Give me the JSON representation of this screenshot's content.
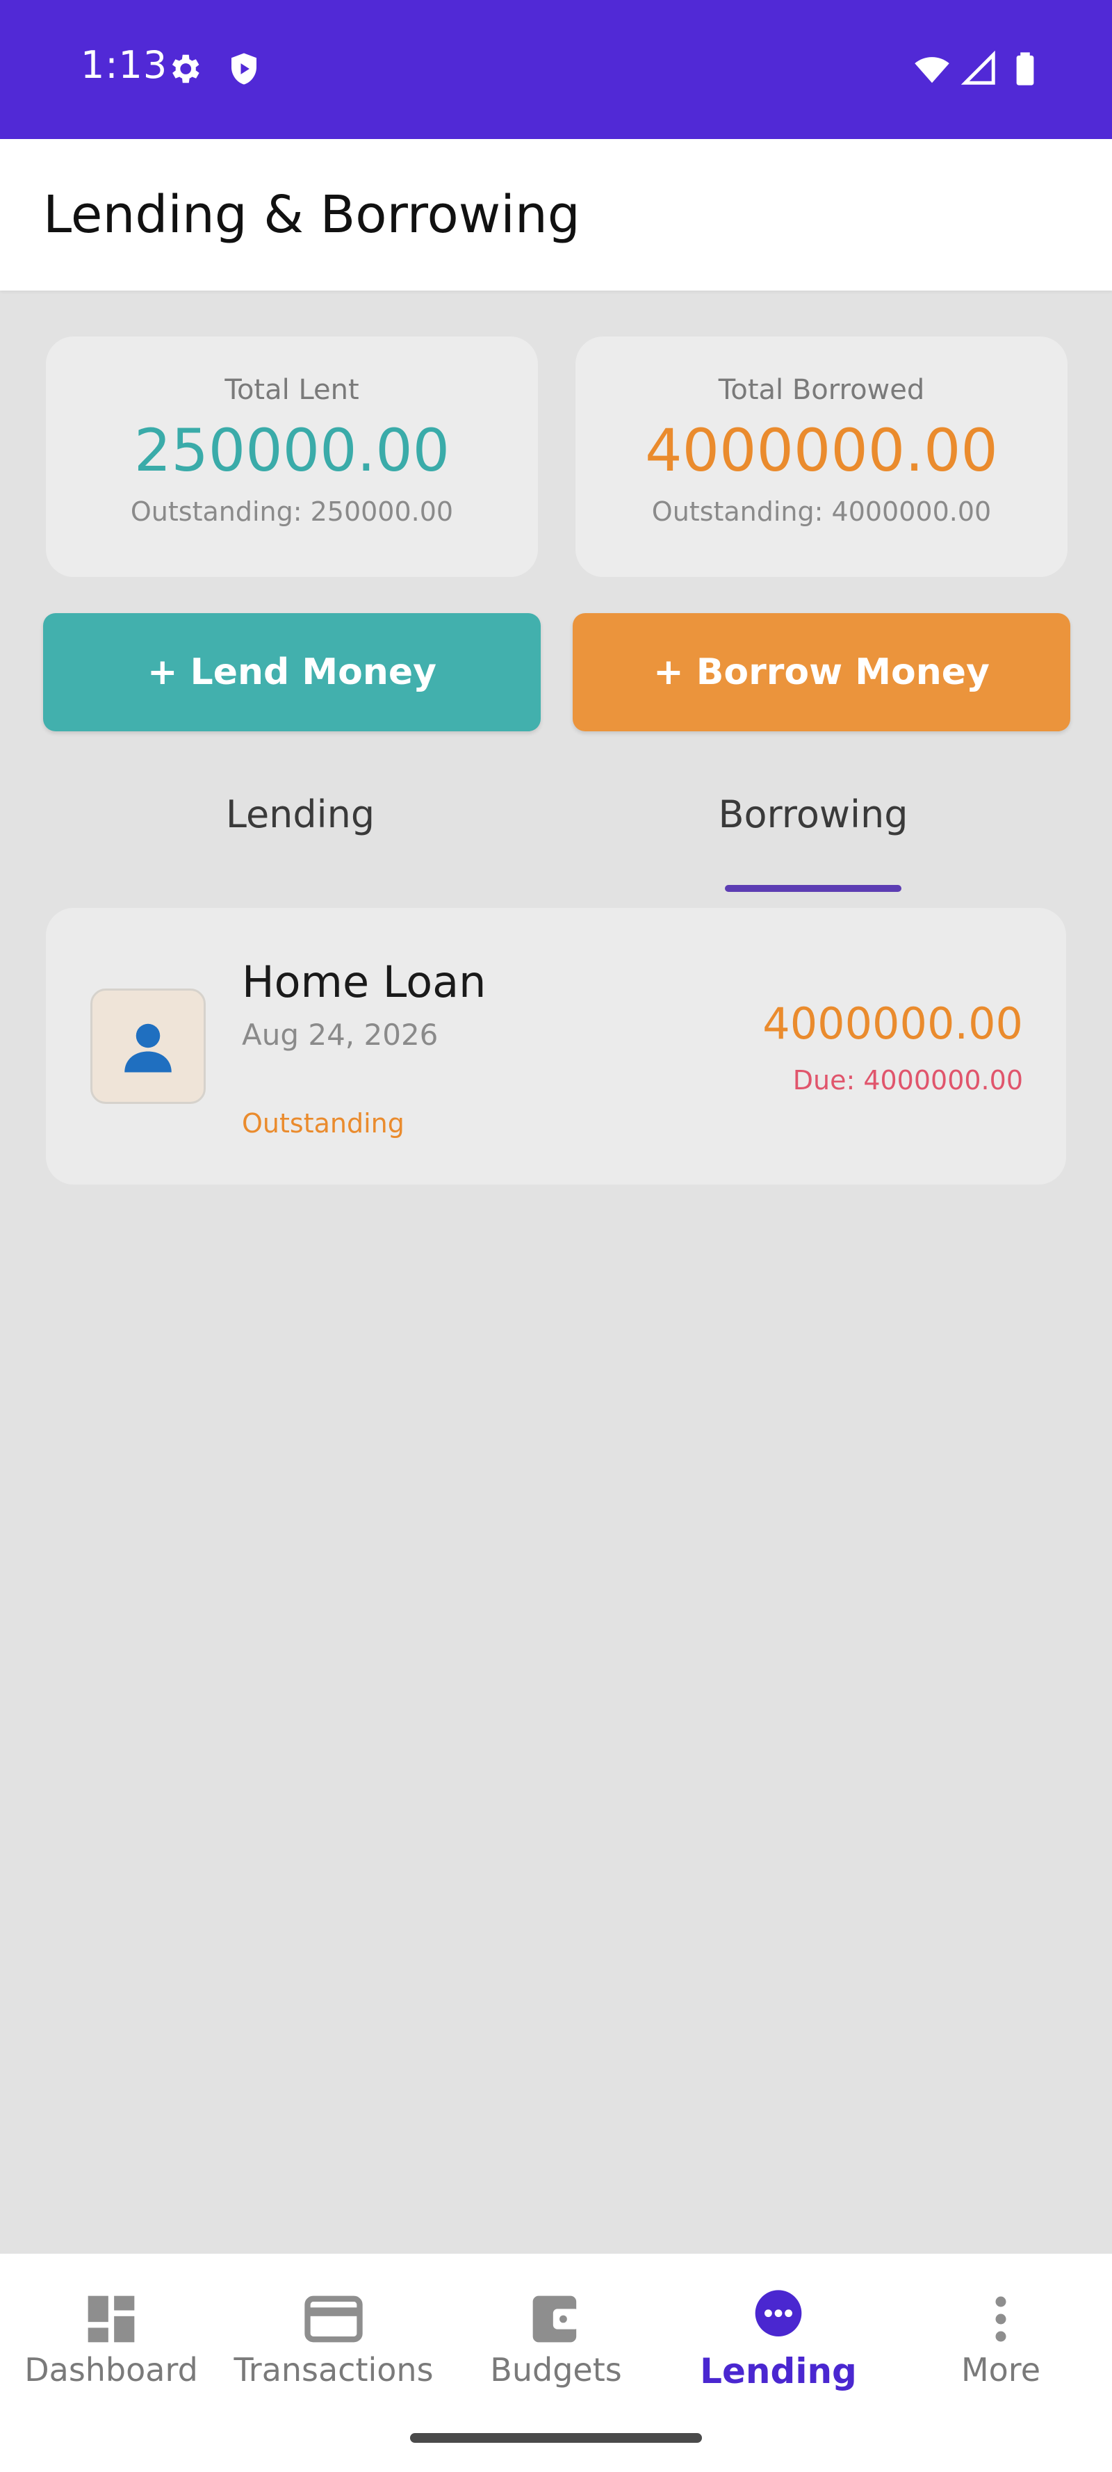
{
  "status_bar": {
    "time": "1:13"
  },
  "app_bar": {
    "title": "Lending & Borrowing"
  },
  "summary": {
    "lent": {
      "label": "Total Lent",
      "amount": "250000.00",
      "outstanding": "Outstanding: 250000.00"
    },
    "borrowed": {
      "label": "Total Borrowed",
      "amount": "4000000.00",
      "outstanding": "Outstanding: 4000000.00"
    }
  },
  "actions": {
    "lend": "+ Lend Money",
    "borrow": "+ Borrow Money"
  },
  "tabs": [
    {
      "label": "Lending",
      "selected": false
    },
    {
      "label": "Borrowing",
      "selected": true
    }
  ],
  "loans": [
    {
      "name": "Home Loan",
      "date": "Aug 24, 2026",
      "status": "Outstanding",
      "amount": "4000000.00",
      "due": "Due: 4000000.00"
    }
  ],
  "nav": [
    {
      "label": "Dashboard",
      "icon": "dashboard-icon"
    },
    {
      "label": "Transactions",
      "icon": "credit-card-icon"
    },
    {
      "label": "Budgets",
      "icon": "wallet-icon"
    },
    {
      "label": "Lending",
      "icon": "more-horizontal-circle-icon",
      "active": true
    },
    {
      "label": "More",
      "icon": "more-vertical-icon"
    }
  ],
  "colors": {
    "primary": "#5129d6",
    "lend_teal": "#42b0ad",
    "borrow_orange": "#eb943c",
    "due_red": "#e0556c"
  }
}
